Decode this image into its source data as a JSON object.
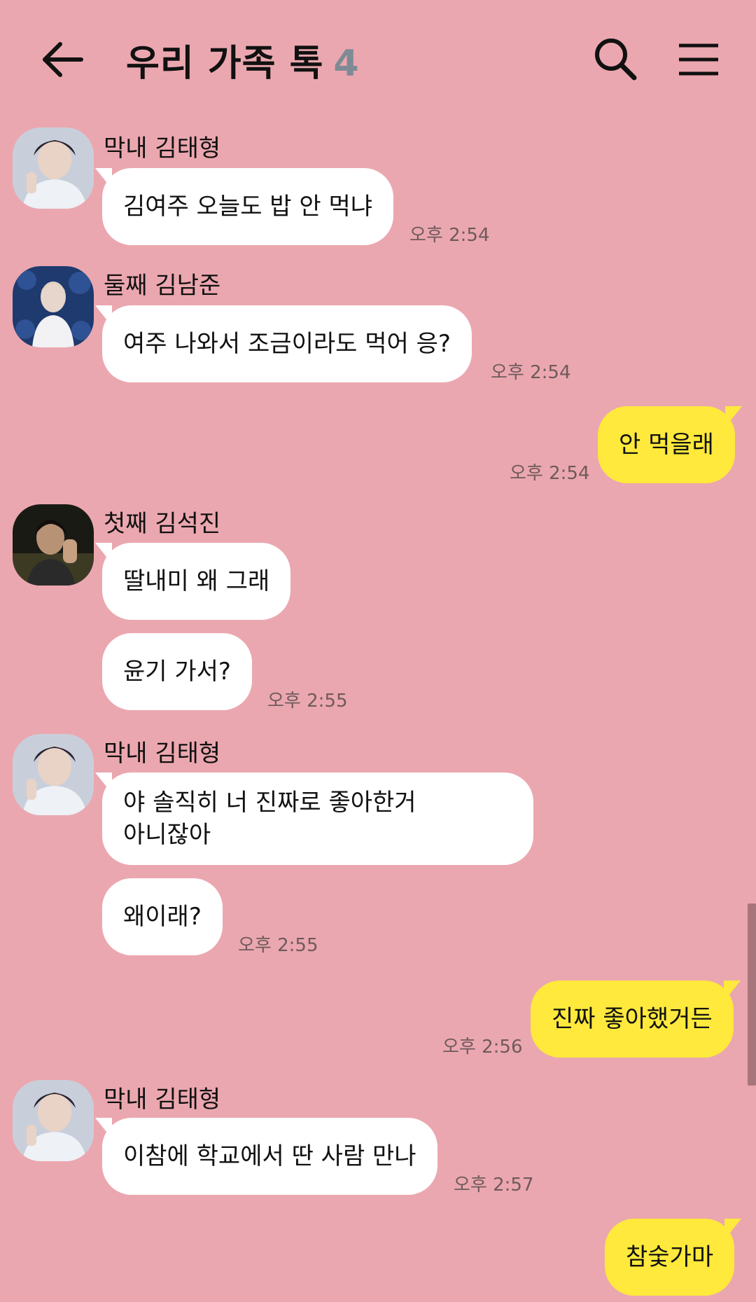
{
  "header": {
    "title": "우리 가족 톡",
    "member_count": "4",
    "icons": {
      "back": "back-arrow-icon",
      "search": "search-icon",
      "menu": "hamburger-menu-icon"
    }
  },
  "colors": {
    "background": "#EBA7AF",
    "incoming_bubble": "#FFFFFF",
    "outgoing_bubble": "#FEE93C",
    "member_count": "#7E8A94",
    "timestamp": "#6E5A5C"
  },
  "messages": [
    {
      "sender": "막내 김태형",
      "text": "김여주 오늘도 밥 안 먹냐",
      "time": "오후 2:54"
    },
    {
      "sender": "둘째 김남준",
      "text": "여주 나와서 조금이라도 먹어 응?",
      "time": "오후 2:54"
    },
    {
      "text": "안 먹을래",
      "time": "오후 2:54"
    },
    {
      "sender": "첫째 김석진",
      "text": "딸내미 왜 그래"
    },
    {
      "text": "윤기 가서?",
      "time": "오후 2:55"
    },
    {
      "sender": "막내 김태형",
      "text_line1": "야 솔직히 너 진짜로 좋아한거",
      "text_line2": "아니잖아"
    },
    {
      "text": "왜이래?",
      "time": "오후 2:55"
    },
    {
      "text": "진짜 좋아했거든",
      "time": "오후 2:56"
    },
    {
      "sender": "막내 김태형",
      "text": "이참에 학교에서 딴 사람 만나",
      "time": "오후 2:57"
    },
    {
      "text": "참숯가마"
    }
  ]
}
